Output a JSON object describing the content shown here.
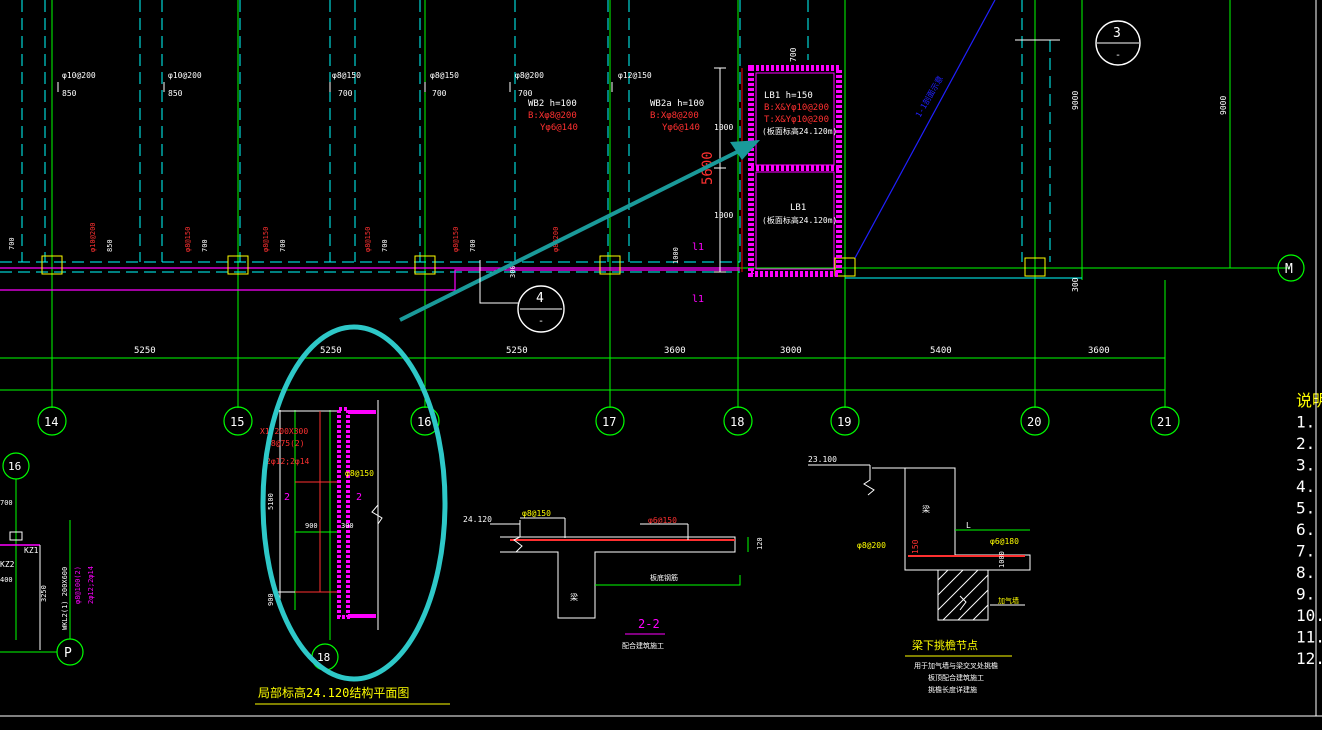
{
  "colors": {
    "background": "#000000",
    "grid_line": "#00ff00",
    "dashed_line": "#00ffff",
    "magenta": "#ff00ff",
    "red_text": "#ff3030",
    "white": "#ffffff",
    "yellow": "#ffff00",
    "highlight": "#2ec8c8",
    "arrow": "#1a9a9a",
    "blue": "#2020ff"
  },
  "axes_bottom": [
    {
      "label": "14"
    },
    {
      "label": "15"
    },
    {
      "label": "16"
    },
    {
      "label": "17"
    },
    {
      "label": "18"
    },
    {
      "label": "19"
    },
    {
      "label": "20"
    },
    {
      "label": "21"
    }
  ],
  "axes_side": {
    "m": "M",
    "p": "P",
    "sixteen": "16",
    "eighteen": "18"
  },
  "spans": [
    "5250",
    "5250",
    "5250",
    "3600",
    "3000",
    "5400",
    "3600"
  ],
  "top_rebar": [
    "φ10@200",
    "φ10@200",
    "φ8@150",
    "φ8@150",
    "φ8@200",
    "φ12@150"
  ],
  "top_dims": [
    "850",
    "850",
    "700",
    "700",
    "700"
  ],
  "vertical_dims": [
    "700",
    "850",
    "700",
    "700",
    "700",
    "700",
    "300",
    "1000",
    "1000"
  ],
  "slab_labels": {
    "wb2_title": "WB2 h=100",
    "wb2_bx": "B:Xφ8@200",
    "wb2_y": "Yφ6@140",
    "wb2a_title": "WB2a h=100",
    "wb2a_bx": "B:Xφ8@200",
    "wb2a_y": "Yφ6@140"
  },
  "lb1_top": {
    "title": "LB1 h=150",
    "line1": "B:X&Yφ10@200",
    "line2": "T:X&Yφ10@200",
    "note": "(板面标高24.120m)"
  },
  "lb1_bottom": {
    "title": "LB1",
    "note": "(板面标高24.120m)"
  },
  "lb_dims": {
    "d1": "1000",
    "d2": "1000",
    "big": "5600",
    "top": "700"
  },
  "section_refs": {
    "four": "4",
    "three": "3",
    "dash": "-"
  },
  "right_dims": {
    "d1": "9000",
    "d2": "9000",
    "d3": "300"
  },
  "l1_labels": [
    "l1",
    "l1"
  ],
  "partial_plan": {
    "beam_text1": "X1 200X300",
    "beam_text2": "φ8@75(2)",
    "beam_text3": "2φ12;2φ14",
    "rebar": "φ8@150",
    "dim_5100": "5100",
    "dim_900a": "900",
    "dim_900b": "900",
    "dim_300": "300",
    "label_2a": "2",
    "label_2b": "2",
    "title": "局部标高24.120结构平面图"
  },
  "left_detail": {
    "dim_700": "700",
    "kz1": "KZ1",
    "kz2": "KZ2",
    "dim_3250": "3250",
    "wkl": "WKL2(1) 200X600",
    "wkl2": "φ8@100(2)",
    "wkl3": "2φ12;2φ14",
    "dim_400": "400"
  },
  "section_22": {
    "elev": "24.120",
    "rebar1": "φ8@150",
    "rebar2": "φ6@150",
    "dim": "120",
    "mark": "梁",
    "label": "2-2",
    "note": "板底钢筋",
    "subtitle": "配合建筑施工"
  },
  "beam_detail": {
    "elev": "23.100",
    "r1": "φ8@200",
    "r2": "φ6@180",
    "dim_150": "150",
    "dim_1000": "1000",
    "mark": "梁",
    "L": "L",
    "wall": "加气墙",
    "title": "梁下挑檐节点",
    "n1": "用于加气墙与梁交叉处挑檐",
    "n2": "板顶配合建筑施工",
    "n3": "挑檐长度详建施"
  },
  "notes": [
    "说明",
    "1.",
    "2.",
    "3.",
    "4.",
    "5.",
    "6.",
    "7.",
    "8.",
    "9.",
    "10.",
    "11.",
    "12."
  ],
  "blue_line_text": "1-1剖面示意"
}
